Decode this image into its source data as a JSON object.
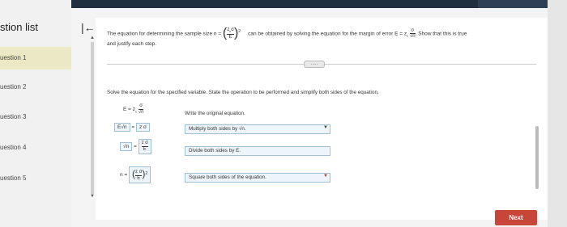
{
  "sidebar": {
    "title": "stion list",
    "items": [
      {
        "label": "uestion 1",
        "active": true
      },
      {
        "label": "uestion 2",
        "active": false
      },
      {
        "label": "uestion 3",
        "active": false
      },
      {
        "label": "uestion 4",
        "active": false
      },
      {
        "label": "uestion 5",
        "active": false
      }
    ]
  },
  "header": {
    "collapse_icon": "|←"
  },
  "question": {
    "text_part1": "The equation for determining the sample size n =",
    "text_part2": "can be obtained by solving the equation for the margin of error E = z",
    "text_part3": ". Show that this is true",
    "text_line2": "and justify each step.",
    "frac_num": "z",
    "frac_num_sub": "c",
    "frac_num_sym": "σ",
    "frac_den": "E",
    "exp": "2",
    "sigma": "σ",
    "sqrt_n": "√n",
    "more_label": "....."
  },
  "instruction": "Solve the equation for the specified variable. State the operation to be performed and simplify both sides of the equation.",
  "steps": [
    {
      "lhs": "E =",
      "rhs_frac_num": "σ",
      "rhs_frac_den": "√n",
      "rhs_prefix": "z",
      "reason": "Write the original equation."
    },
    {
      "lhs": "E√n",
      "rhs": "z σ",
      "reason": "Multiply both sides by √n."
    },
    {
      "lhs": "√n",
      "rhs_frac_num": "z σ",
      "rhs_frac_den": "E",
      "reason": "Divide both sides by E."
    },
    {
      "lhs": "n =",
      "rhs_frac_num": "z σ",
      "rhs_frac_den": "E",
      "exp": "2",
      "reason": "Square both sides of the equation."
    }
  ],
  "footer": {
    "next_label": "Next"
  },
  "colors": {
    "next_bg": "#c8453a",
    "active_item": "#ece7c4",
    "box_border": "#9fbfd4"
  }
}
